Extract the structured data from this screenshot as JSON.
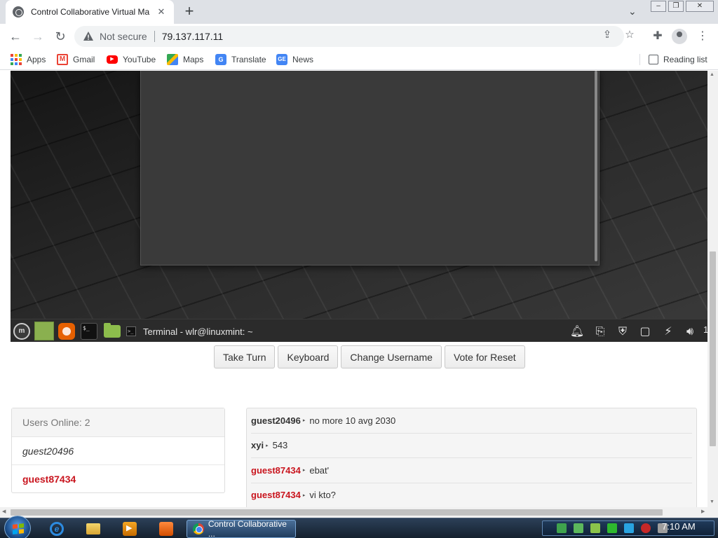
{
  "browser": {
    "tab_title": "Control Collaborative Virtual Ma",
    "not_secure": "Not secure",
    "url": "79.137.117.11",
    "bookmarks": [
      {
        "label": "Apps"
      },
      {
        "label": "Gmail"
      },
      {
        "label": "YouTube"
      },
      {
        "label": "Maps"
      },
      {
        "label": "Translate"
      },
      {
        "label": "News"
      }
    ],
    "reading_list": "Reading list"
  },
  "vm": {
    "taskbar_window": "Terminal - wlr@linuxmint: ~",
    "mint_logo": "m",
    "term_glyph": "$_",
    "tray_trailing": "1"
  },
  "controls": {
    "take_turn": "Take Turn",
    "keyboard": "Keyboard",
    "change_username": "Change Username",
    "vote_reset": "Vote for Reset"
  },
  "users": {
    "header": "Users Online: 2",
    "list": [
      "guest20496",
      "guest87434"
    ]
  },
  "chat": {
    "messages": [
      {
        "user": "guest20496",
        "text": "no more 10 avg 2030"
      },
      {
        "user": "xyi",
        "text": "543"
      },
      {
        "user": "guest87434",
        "text": "ebat'"
      },
      {
        "user": "guest87434",
        "text": "vi kto?"
      }
    ]
  },
  "os_taskbar": {
    "active_window": "Control Collaborative ...",
    "clock": "7:10 AM"
  },
  "colors": {
    "accent_red": "#c9151e",
    "chrome_tabstrip": "#dee1e6",
    "win7_taskbar": "#14202e"
  }
}
